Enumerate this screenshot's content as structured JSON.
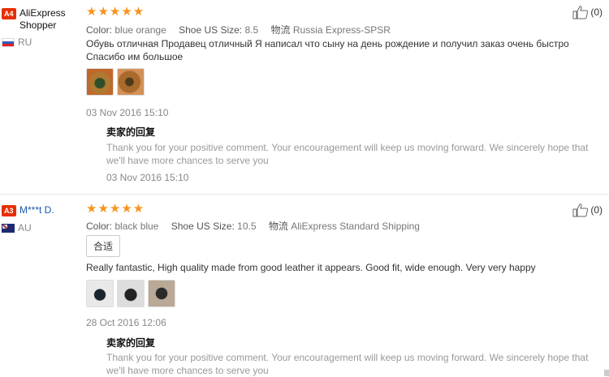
{
  "reviews": [
    {
      "level": "A4",
      "level_color": "#e62e04",
      "username": "AliExpress Shopper",
      "country": "RU",
      "meta": {
        "color_label": "Color:",
        "color_value": "blue orange",
        "size_label": "Shoe US Size:",
        "size_value": "8.5",
        "logistics_label": "物流",
        "logistics_value": "Russia Express-SPSR"
      },
      "text": "Обувь отличная Продавец отличный Я написал что сыну на день рождение и получил заказ очень быстро Спасибо им большое",
      "date": "03 Nov 2016 15:10",
      "reply_title": "卖家的回复",
      "reply_text": "Thank you for your positive comment. Your encouragement will keep us moving forward. We sincerely hope that we'll have more chances to serve you",
      "reply_date": "03 Nov 2016 15:10",
      "helpful": "(0)"
    },
    {
      "level": "A3",
      "level_color": "#e62e04",
      "username": "M***t D.",
      "country": "AU",
      "meta": {
        "color_label": "Color:",
        "color_value": "black blue",
        "size_label": "Shoe US Size:",
        "size_value": "10.5",
        "logistics_label": "物流",
        "logistics_value": "AliExpress Standard Shipping"
      },
      "tag": "合适",
      "text": "Really fantastic, High quality made from good leather it appears. Good fit, wide enough. Very very happy",
      "date": "28 Oct 2016 12:06",
      "reply_title": "卖家的回复",
      "reply_text": "Thank you for your positive comment. Your encouragement will keep us moving forward. We sincerely hope that we'll have more chances to serve you",
      "helpful": "(0)"
    }
  ],
  "stars": "★★★★★"
}
